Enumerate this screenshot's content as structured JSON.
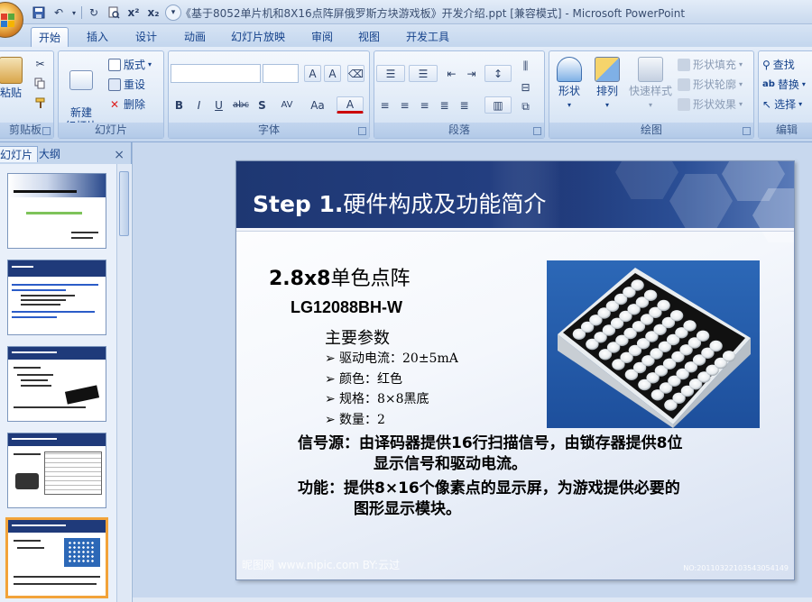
{
  "window": {
    "title": "《基于8052单片机和8X16点阵屏俄罗斯方块游戏板》开发介绍.ppt [兼容模式] - Microsoft PowerPoint"
  },
  "quick_access": [
    "save-icon",
    "undo-icon",
    "redo-icon",
    "print-preview-icon",
    "superscript-icon",
    "subscript-icon",
    "customize-icon"
  ],
  "quick_access_labels": {
    "superscript": "x²",
    "subscript": "x₂"
  },
  "ribbon_tabs": [
    "开始",
    "插入",
    "设计",
    "动画",
    "幻灯片放映",
    "审阅",
    "视图",
    "开发工具"
  ],
  "active_tab": "开始",
  "groups": {
    "clipboard": {
      "label": "剪贴板",
      "paste": "粘贴"
    },
    "slides": {
      "label": "幻灯片",
      "new_slide": "新建\n幻灯片",
      "layout": "版式",
      "reset": "重设",
      "delete": "删除"
    },
    "font": {
      "label": "字体",
      "font_name": "",
      "font_size": "",
      "bold": "B",
      "italic": "I",
      "underline": "U",
      "strike": "abc",
      "shadow": "S",
      "spacing": "AV",
      "case": "Aa",
      "color": "A",
      "grow": "A",
      "shrink": "A"
    },
    "paragraph": {
      "label": "段落"
    },
    "drawing": {
      "label": "绘图",
      "shapes": "形状",
      "arrange": "排列",
      "quick_styles": "快速样式",
      "fill": "形状填充",
      "outline": "形状轮廓",
      "effects": "形状效果"
    },
    "editing": {
      "label": "编辑",
      "find": "查找",
      "replace": "替换",
      "select": "选择"
    }
  },
  "left_pane": {
    "tab_slides": "幻灯片",
    "tab_outline": "大纲",
    "close": "×"
  },
  "slide": {
    "title_step": "Step 1.",
    "title_text": "硬件构成及功能简介",
    "heading_num": "2.8x8",
    "heading_text": "单色点阵",
    "model": "LG12088BH-W",
    "params_title": "主要参数",
    "bullets": [
      "驱动电流：20±5mA",
      "颜色：红色",
      "规格：8×8黑底",
      "数量：2"
    ],
    "signal_line1": "信号源：由译码器提供16行扫描信号，由锁存器提供8位",
    "signal_line2": "显示信号和驱动电流。",
    "function_line1": "功能：提供8×16个像素点的显示屏，为游戏提供必要的",
    "function_line2": "图形显示模块。",
    "watermark": "昵图网 www.nipic.com  BY:云过",
    "watermark_id": "NO:20110322103543054149"
  },
  "colors": {
    "accent": "#15428b",
    "slide_header_dark": "#203a7a",
    "selected_thumb": "#f2a33a"
  }
}
